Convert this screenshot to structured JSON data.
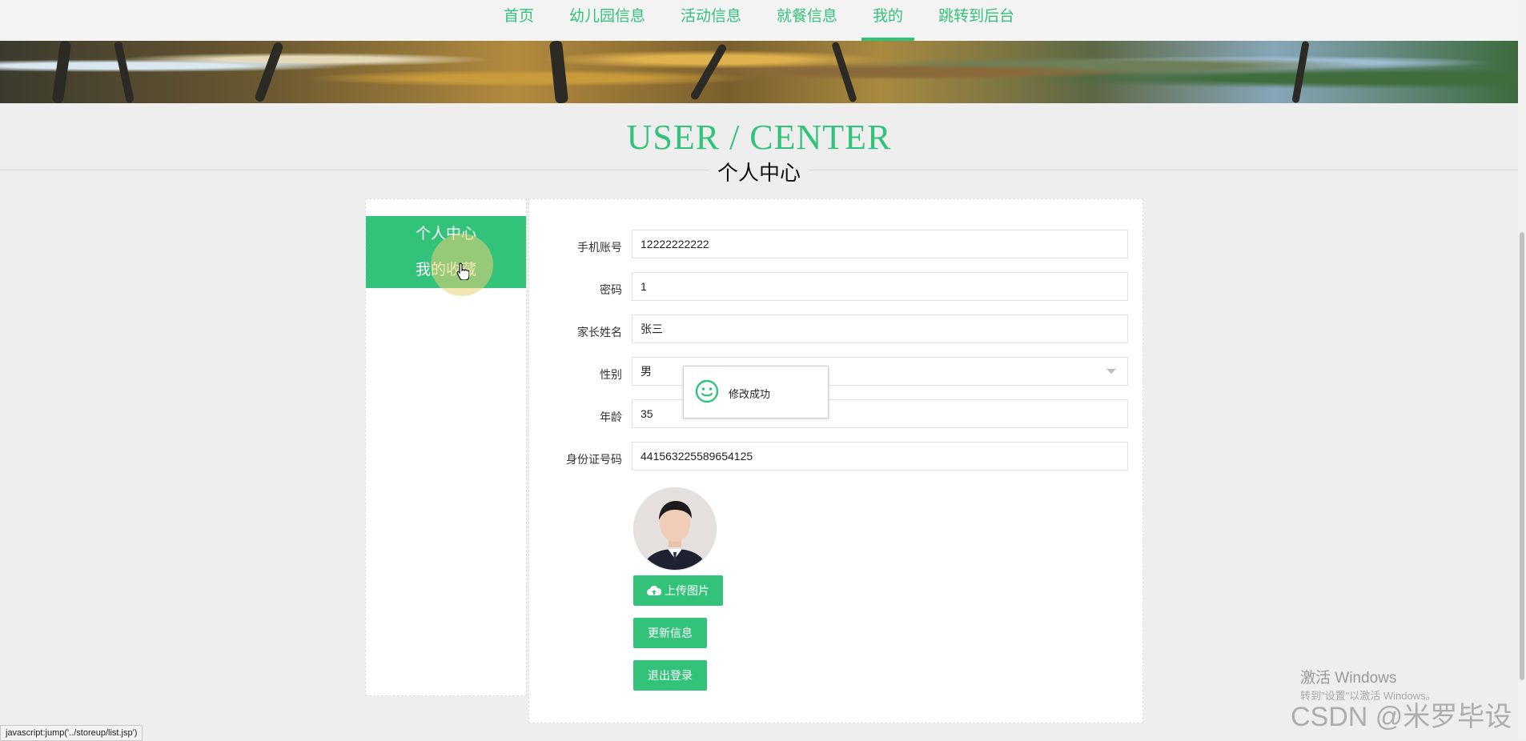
{
  "nav": {
    "items": [
      {
        "label": "首页"
      },
      {
        "label": "幼儿园信息"
      },
      {
        "label": "活动信息"
      },
      {
        "label": "就餐信息"
      },
      {
        "label": "我的"
      },
      {
        "label": "跳转到后台"
      }
    ],
    "active_index": 4
  },
  "header": {
    "title_en": "USER / CENTER",
    "title_cn": "个人中心"
  },
  "sidebar": {
    "items": [
      {
        "label": "个人中心"
      },
      {
        "label": "我的收藏"
      }
    ]
  },
  "form": {
    "fields": [
      {
        "label": "手机账号",
        "value": "12222222222"
      },
      {
        "label": "密码",
        "value": "1"
      },
      {
        "label": "家长姓名",
        "value": "张三"
      },
      {
        "label": "性别",
        "value": "男"
      },
      {
        "label": "年龄",
        "value": "35"
      },
      {
        "label": "身份证号码",
        "value": "441563225589654125"
      }
    ]
  },
  "buttons": {
    "upload": "上传图片",
    "update": "更新信息",
    "logout": "退出登录"
  },
  "toast": {
    "message": "修改成功"
  },
  "statusbar": {
    "text": "javascript:jump('../storeup/list.jsp')"
  },
  "overlay": {
    "activate_title": "激活 Windows",
    "activate_sub": "转到\"设置\"以激活 Windows。",
    "watermark": "CSDN @米罗毕设"
  },
  "colors": {
    "accent": "#33c27a",
    "background": "#eeeeee"
  }
}
